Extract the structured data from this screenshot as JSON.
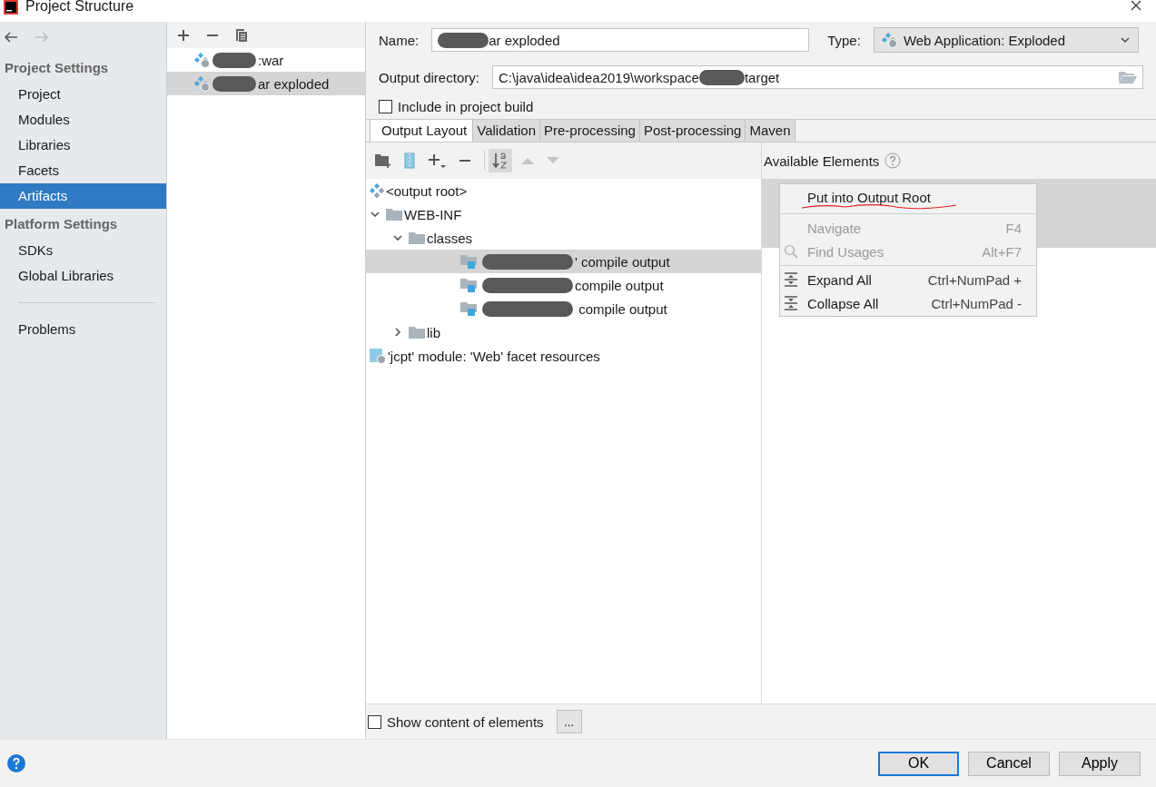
{
  "window": {
    "title": "Project Structure"
  },
  "sidebar": {
    "sections": [
      {
        "heading": "Project Settings",
        "items": [
          {
            "label": "Project",
            "selected": false
          },
          {
            "label": "Modules",
            "selected": false
          },
          {
            "label": "Libraries",
            "selected": false
          },
          {
            "label": "Facets",
            "selected": false
          },
          {
            "label": "Artifacts",
            "selected": true
          }
        ]
      },
      {
        "heading": "Platform Settings",
        "items": [
          {
            "label": "SDKs",
            "selected": false
          },
          {
            "label": "Global Libraries",
            "selected": false
          }
        ]
      }
    ],
    "extra_items": [
      {
        "label": "Problems",
        "selected": false
      }
    ]
  },
  "artifacts": [
    {
      "label": ":war",
      "selected": false,
      "redacted": true
    },
    {
      "label": "ar exploded",
      "selected": true,
      "redacted": true
    }
  ],
  "form": {
    "name_label": "Name:",
    "name_value": "ar exploded",
    "name_redacted": true,
    "type_label": "Type:",
    "type_value": "Web Application: Exploded",
    "output_dir_label": "Output directory:",
    "output_dir_value": "C:\\java\\idea\\idea2019\\workspace",
    "output_dir_value_tail": "target",
    "include_build": {
      "label": "Include in project build",
      "checked": false
    }
  },
  "tabs": [
    {
      "label": "Output Layout",
      "selected": true
    },
    {
      "label": "Validation",
      "selected": false
    },
    {
      "label": "Pre-processing",
      "selected": false
    },
    {
      "label": "Post-processing",
      "selected": false
    },
    {
      "label": "Maven",
      "selected": false
    }
  ],
  "available_elements": {
    "label": "Available Elements"
  },
  "tree": [
    {
      "kind": "root",
      "label": "<output root>",
      "selected": false
    },
    {
      "kind": "folder",
      "label": "WEB-INF",
      "expanded": true,
      "selected": false,
      "children": [
        {
          "kind": "folder",
          "label": "classes",
          "expanded": true,
          "selected": false,
          "children": [
            {
              "kind": "output",
              "label": "' compile output",
              "selected": true,
              "redacted": true
            },
            {
              "kind": "output",
              "label": "compile output",
              "selected": false,
              "redacted": true
            },
            {
              "kind": "output",
              "label": " compile output",
              "selected": false,
              "redacted": true
            }
          ]
        },
        {
          "kind": "folder",
          "label": "lib",
          "expanded": false,
          "selected": false
        }
      ]
    },
    {
      "kind": "resources",
      "label": "'jcpt' module: 'Web' facet resources",
      "selected": false
    }
  ],
  "context_menu": {
    "items": [
      {
        "kind": "plain",
        "label": "Put into Output Root",
        "disabled": false,
        "separated": false,
        "annotated": true
      },
      {
        "kind": "plain",
        "label": "Navigate",
        "shortcut": "F4",
        "disabled": true,
        "separated": true,
        "annotated": false
      },
      {
        "kind": "search",
        "label": "Find Usages",
        "shortcut": "Alt+F7",
        "disabled": true,
        "separated": false,
        "annotated": false
      },
      {
        "kind": "expand",
        "label": "Expand All",
        "shortcut": "Ctrl+NumPad +",
        "disabled": false,
        "separated": true,
        "annotated": false
      },
      {
        "kind": "collapse",
        "label": "Collapse All",
        "shortcut": "Ctrl+NumPad -",
        "disabled": false,
        "separated": false,
        "annotated": false
      }
    ]
  },
  "show_content": {
    "label": "Show content of elements",
    "checked": false,
    "more": "..."
  },
  "buttons": [
    {
      "label": "OK",
      "kind": "default"
    },
    {
      "label": "Cancel",
      "kind": "normal"
    },
    {
      "label": "Apply",
      "kind": "normal"
    }
  ]
}
